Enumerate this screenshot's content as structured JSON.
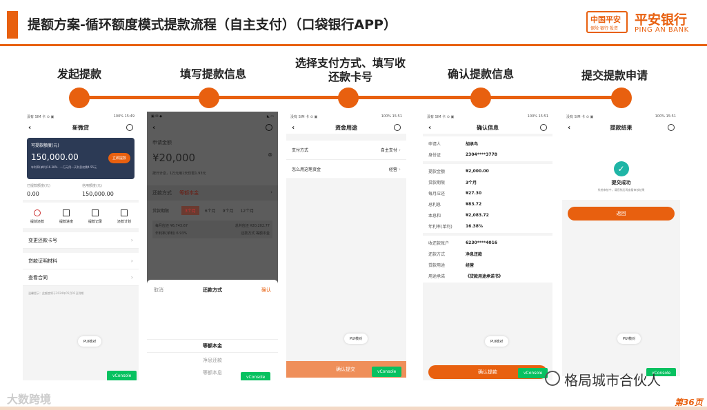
{
  "header": {
    "title": "提额方案-循环额度模式提款流程（自主支付）（口袋银行APP）",
    "logo_cn": "中国平安",
    "logo_sub": "保险·银行·投资",
    "logo_name": "平安银行",
    "logo_en": "PING AN BANK"
  },
  "steps": [
    {
      "label": "发起提款"
    },
    {
      "label": "填写提款信息"
    },
    {
      "label": "选择支付方式、填写收还款卡号"
    },
    {
      "label": "确认提款信息"
    },
    {
      "label": "提交提款申请"
    }
  ],
  "phone1": {
    "status_left": "没有 SIM 卡 ⊙ ▣",
    "status_right": "100% 15:49",
    "title": "新微贷",
    "card_label": "可提款额度(元)",
    "card_amount": "150,000.00",
    "card_button": "立即提款",
    "card_note": "年利率(单利)16.38% · 一万元用一天利息仅需4.55元",
    "used_label": "已提款额度(元)",
    "used_value": "0.00",
    "credit_label": "信用额度(元)",
    "credit_value": "150,000.00",
    "actions": [
      "提前还款",
      "提款进度",
      "提款记录",
      "还款计划"
    ],
    "menu": [
      "变更还款卡号",
      "贷款证明材料",
      "查看合同"
    ],
    "tip": "温馨提示：此额度将于2024年05月02日到期",
    "pui": "PUI核对",
    "vconsole": "vConsole"
  },
  "phone2": {
    "title": "",
    "apply_label": "申请金额",
    "amount": "¥20,000",
    "note": "按日计息，1万元用1天仅需1.93元",
    "method_label": "还款方式",
    "method_value": "等额本金",
    "term_label": "贷款期限",
    "terms": [
      "3个月",
      "6个月",
      "9个月",
      "12个月"
    ],
    "monthly_label": "每月应还",
    "monthly_value": "¥6,743.67",
    "total_label": "总共应还",
    "total_value": "¥20,202.77",
    "rate_label": "年利率(单利)",
    "rate_value": "6.93%",
    "method2_label": "还款方式",
    "method2_value": "等额本金",
    "sheet_cancel": "取消",
    "sheet_title": "还款方式",
    "sheet_confirm": "确认",
    "options": [
      "等额本金",
      "净息还款",
      "等额本息"
    ],
    "vconsole": "vConsole"
  },
  "phone3": {
    "status_left": "没有 SIM 卡 ⊙ ▣",
    "status_right": "100% 15:51",
    "title": "资金用途",
    "pay_label": "支付方式",
    "pay_value": "自主支付",
    "use_label": "怎么用这笔资金",
    "use_value": "经营",
    "pui": "PUI核对",
    "submit": "确认提交",
    "vconsole": "vConsole"
  },
  "phone4": {
    "status_left": "没有 SIM 卡 ⊙ ▣",
    "status_right": "100% 15:51",
    "title": "确认信息",
    "rows": [
      {
        "label": "申请人",
        "value": "胡承鸟"
      },
      {
        "label": "身份证",
        "value": "2304****3778"
      },
      {
        "label": "提款金额",
        "value": "¥2,000.00"
      },
      {
        "label": "贷款期限",
        "value": "3个月"
      },
      {
        "label": "每月应还",
        "value": "¥27.30"
      },
      {
        "label": "总利息",
        "value": "¥83.72"
      },
      {
        "label": "本息和",
        "value": "¥2,083.72"
      },
      {
        "label": "年利率(单利)",
        "value": "16.38%"
      },
      {
        "label": "收还款账户",
        "value": "6230****4016"
      },
      {
        "label": "还款方式",
        "value": "净息还款"
      },
      {
        "label": "贷款用途",
        "value": "经营"
      },
      {
        "label": "用途承诺",
        "value": "《贷款用途承诺书》"
      }
    ],
    "pui": "PUI核对",
    "confirm": "确认提款",
    "vconsole": "vConsole"
  },
  "phone5": {
    "status_left": "没有 SIM 卡 ⊙ ▣",
    "status_right": "100% 15:51",
    "title": "提款结果",
    "success": "提交成功",
    "note": "系统审核中，请您稍后再查看审核结果",
    "back": "返回",
    "pui": "PUI核对",
    "vconsole": "vConsole"
  },
  "watermark_left": "大数跨境",
  "watermark_right": "格局城市合伙人",
  "page_number": "第36页"
}
